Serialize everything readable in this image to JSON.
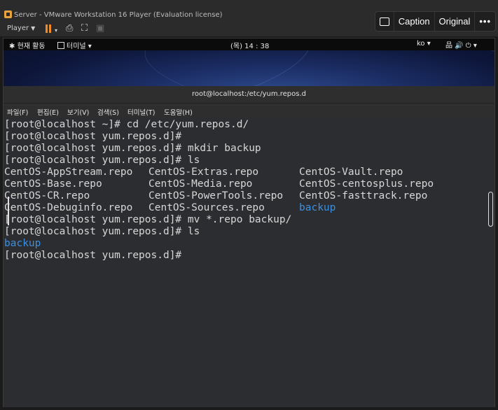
{
  "vmware": {
    "title": "Server - VMware Workstation 16 Player (Evaluation license)",
    "player_label": "Player",
    "player_caret": "▼"
  },
  "overlay": {
    "caption_label": "Caption",
    "original_label": "Original",
    "more_label": "•••"
  },
  "gnome_topbar": {
    "activities": "현재 활동",
    "terminal_menu": "터미널 ▾",
    "clock": "(목) 14 : 38",
    "language": "ko ▾",
    "tray": "品  🔊  ⏻ ▾"
  },
  "terminal": {
    "header_title": "root@localhost:/etc/yum.repos.d",
    "menu": [
      "파일(F)",
      "편집(E)",
      "보기(V)",
      "검색(S)",
      "터미널(T)",
      "도움말(H)"
    ],
    "lines": {
      "l1": "[root@localhost ~]# cd /etc/yum.repos.d/",
      "l2": "[root@localhost yum.repos.d]#",
      "l3": "[root@localhost yum.repos.d]# mkdir backup",
      "l4": "[root@localhost yum.repos.d]# ls",
      "l9": "[root@localhost yum.repos.d]# mv *.repo backup/",
      "l10": "[root@localhost yum.repos.d]# ls",
      "l11": "backup",
      "l12": "[root@localhost yum.repos.d]#"
    },
    "ls_output": [
      [
        "CentOS-AppStream.repo",
        "CentOS-Extras.repo",
        "CentOS-Vault.repo"
      ],
      [
        "CentOS-Base.repo",
        "CentOS-Media.repo",
        "CentOS-centosplus.repo"
      ],
      [
        "CentOS-CR.repo",
        "CentOS-PowerTools.repo",
        "CentOS-fasttrack.repo"
      ],
      [
        "CentOS-Debuginfo.repo",
        "CentOS-Sources.repo",
        "backup"
      ]
    ],
    "dir_color": "#3d8fe0"
  }
}
